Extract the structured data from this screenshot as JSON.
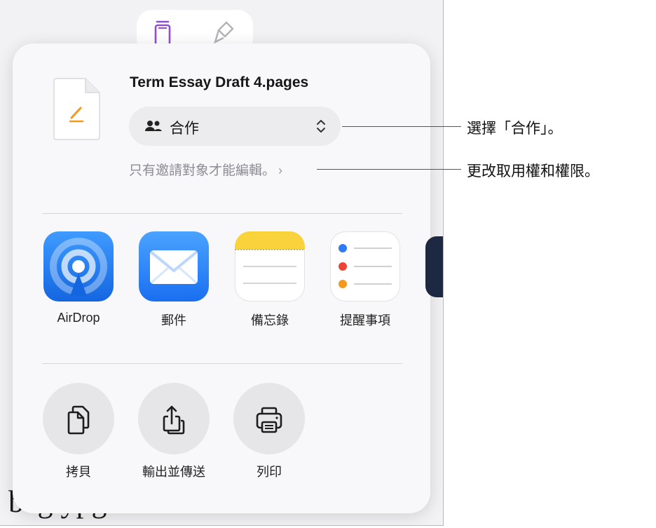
{
  "document": {
    "visible_text": "beg ypg"
  },
  "share_sheet": {
    "file_name": "Term Essay Draft 4.pages",
    "collaboration": {
      "icon": "people-icon",
      "label": "合作",
      "chevron": "chevron-up-down-icon"
    },
    "access_summary": "只有邀請對象才能編輯。",
    "access_chevron": "›",
    "apps": [
      {
        "name": "AirDrop",
        "icon": "airdrop-icon"
      },
      {
        "name": "郵件",
        "icon": "mail-icon"
      },
      {
        "name": "備忘錄",
        "icon": "notes-icon"
      },
      {
        "name": "提醒事項",
        "icon": "reminders-icon"
      }
    ],
    "actions": [
      {
        "name": "拷貝",
        "icon": "copy-icon"
      },
      {
        "name": "輸出並傳送",
        "icon": "export-icon"
      },
      {
        "name": "列印",
        "icon": "print-icon"
      }
    ]
  },
  "callouts": [
    "選擇「合作」。",
    "更改取用權和權限。"
  ],
  "colors": {
    "airdrop": "#1e7cf2",
    "mail": "#2f8cf5",
    "notes_yellow": "#f9d33c",
    "accent_purple": "#8e4fd6",
    "pages_orange": "#f39a1c"
  }
}
